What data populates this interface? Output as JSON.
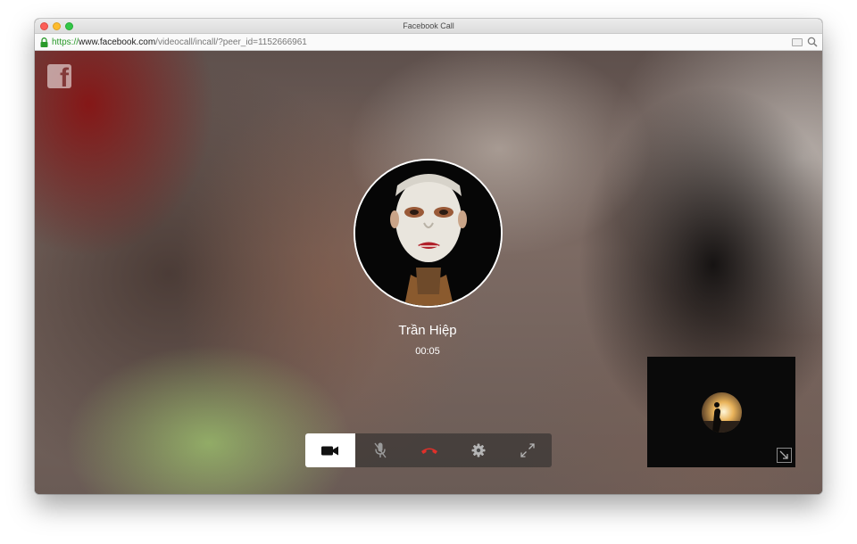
{
  "window": {
    "title": "Facebook Call"
  },
  "address": {
    "scheme": "https://",
    "host": "www.facebook.com",
    "path": "/videocall/incall/?peer_id=1152666961"
  },
  "call": {
    "caller_name": "Trần Hiệp",
    "timer": "00:05"
  },
  "controls": [
    {
      "name": "video-camera-icon",
      "active": true
    },
    {
      "name": "microphone-icon",
      "active": false
    },
    {
      "name": "hang-up-icon",
      "active": false,
      "color": "#e0302a"
    },
    {
      "name": "gear-icon",
      "active": false
    },
    {
      "name": "fullscreen-icon",
      "active": false
    }
  ],
  "icons": {
    "brand": "facebook-logo-icon",
    "lock": "lock-icon",
    "reader": "reader-icon",
    "search": "search-icon",
    "minimize": "minimize-icon"
  },
  "colors": {
    "secure_scheme": "#2a9a2a",
    "hang_up": "#e0302a",
    "close": "#fc5f57",
    "minimize": "#fdbc2e",
    "zoom": "#33c748"
  }
}
